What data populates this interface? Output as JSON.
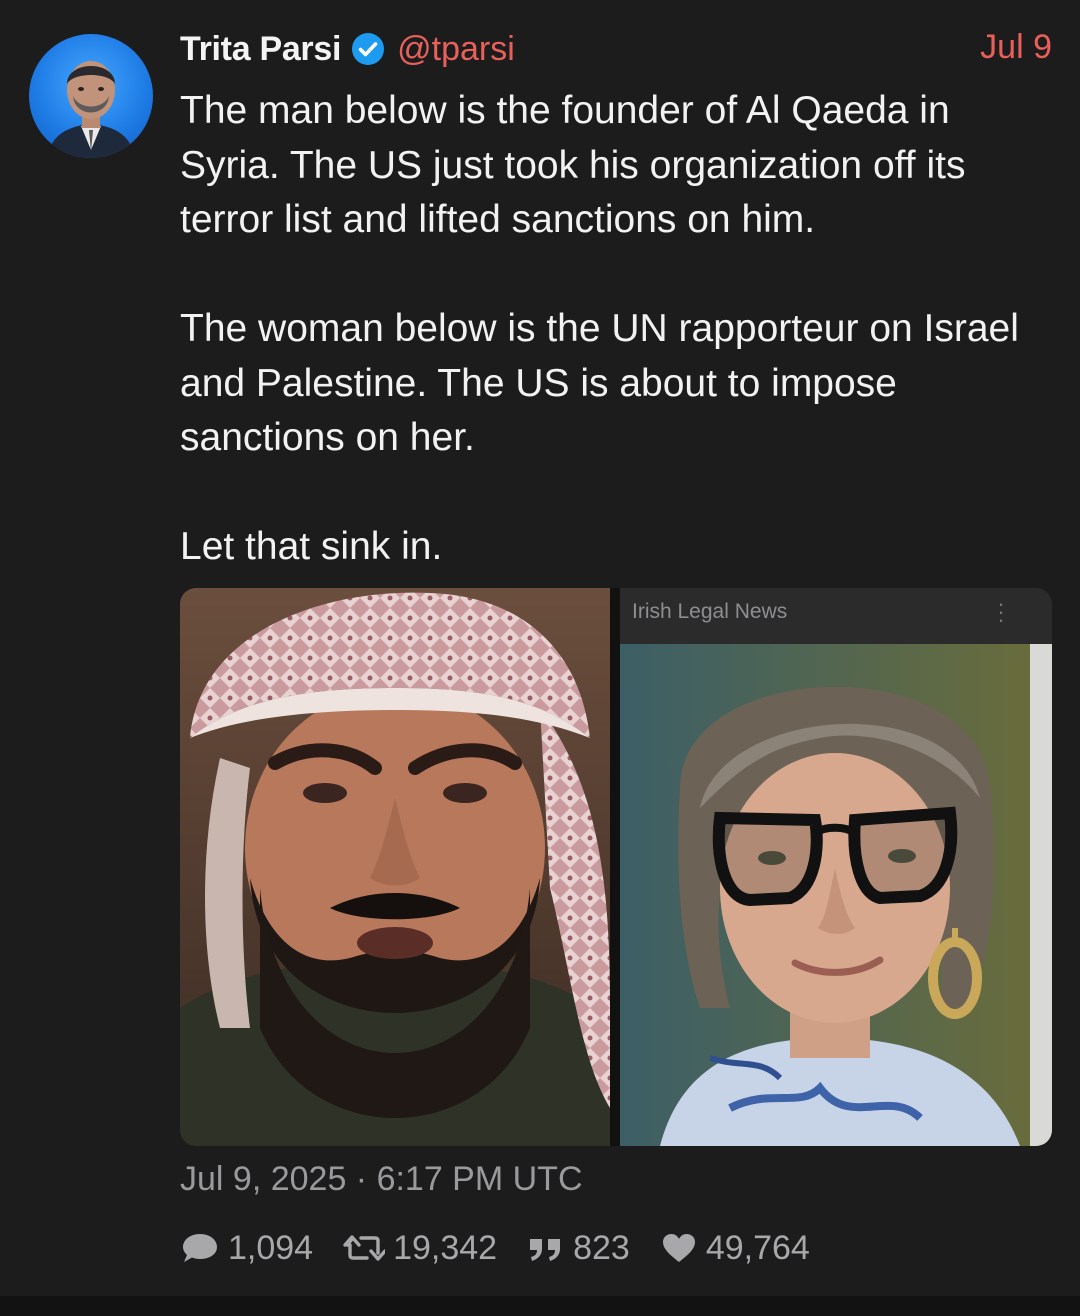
{
  "tweet": {
    "author_name": "Trita Parsi",
    "handle": "@tparsi",
    "date_short": "Jul 9",
    "paragraphs": [
      "The man below is the founder of Al Qaeda in Syria. The US just took his organization off its terror list and lifted sanctions on him.",
      "The woman below is the UN rapporteur on Israel and Palestine. The US is about to impose sanctions on her.",
      "Let that sink in."
    ],
    "media": {
      "right_source_label": "Irish Legal News"
    },
    "timestamp": "Jul 9, 2025 · 6:17 PM UTC",
    "stats": {
      "replies": "1,094",
      "retweets": "19,342",
      "quotes": "823",
      "likes": "49,764"
    }
  },
  "colors": {
    "background": "#1c1c1d",
    "accent": "#e8605a",
    "verified": "#1d9bf0",
    "text": "#f2f2f2",
    "muted": "#9a9a9c"
  },
  "icons": {
    "verified": "verified-badge-icon",
    "reply": "speech-bubble-icon",
    "retweet": "retweet-icon",
    "quote": "quote-icon",
    "like": "heart-icon"
  }
}
